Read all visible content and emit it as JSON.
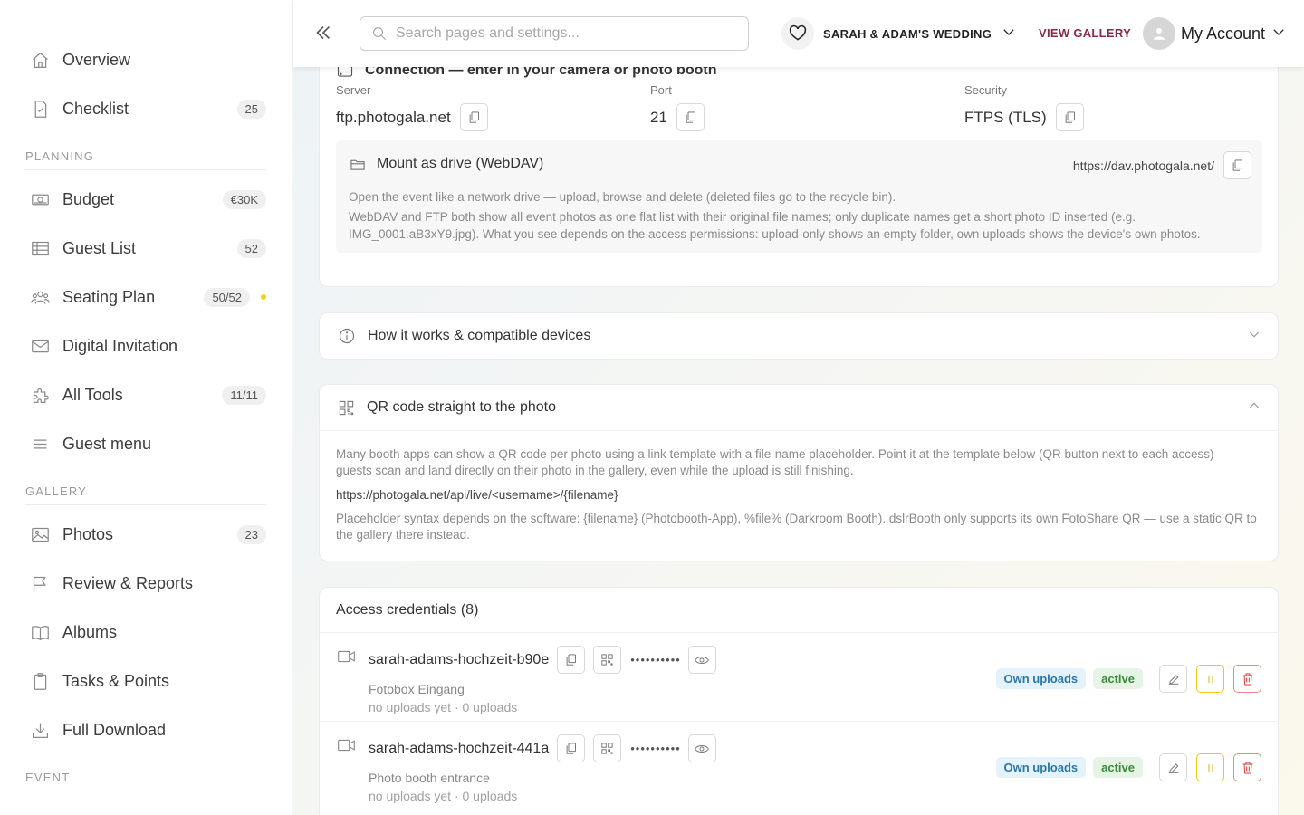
{
  "sidebar": {
    "items_top": [
      {
        "label": "Overview",
        "badge": null,
        "icon": "home-icon"
      },
      {
        "label": "Checklist",
        "badge": "25",
        "icon": "checklist-icon"
      }
    ],
    "section_planning": "PLANNING",
    "items_planning": [
      {
        "label": "Budget",
        "badge": "€30K",
        "icon": "money-icon"
      },
      {
        "label": "Guest List",
        "badge": "52",
        "icon": "table-icon"
      },
      {
        "label": "Seating Plan",
        "badge": "50/52",
        "icon": "people-icon"
      },
      {
        "label": "Digital Invitation",
        "badge": null,
        "icon": "mail-icon"
      },
      {
        "label": "All Tools",
        "badge": "11/11",
        "icon": "puzzle-icon"
      },
      {
        "label": "Guest menu",
        "badge": null,
        "icon": "menu-icon"
      }
    ],
    "section_gallery": "GALLERY",
    "items_gallery": [
      {
        "label": "Photos",
        "badge": "23",
        "icon": "image-icon"
      },
      {
        "label": "Review & Reports",
        "badge": null,
        "icon": "flag-icon"
      },
      {
        "label": "Albums",
        "badge": null,
        "icon": "book-icon"
      },
      {
        "label": "Tasks & Points",
        "badge": null,
        "icon": "clipboard-icon"
      },
      {
        "label": "Full Download",
        "badge": null,
        "icon": "download-icon"
      }
    ],
    "section_event": "EVENT",
    "status_dot_color": "#f5d20c"
  },
  "topbar": {
    "search_placeholder": "Search pages and settings...",
    "event_name": "SARAH & ADAM'S WEDDING",
    "view_gallery": "VIEW GALLERY",
    "account_label": "My Account",
    "accent_color": "#8b2a45"
  },
  "connection": {
    "title": "Connection — enter in your camera or photo booth",
    "server_label": "Server",
    "server_value": "ftp.photogala.net",
    "port_label": "Port",
    "port_value": "21",
    "security_label": "Security",
    "security_value": "FTPS (TLS)",
    "webdav_title": "Mount as drive (WebDAV)",
    "webdav_url": "https://dav.photogala.net/",
    "webdav_text1": "Open the event like a network drive — upload, browse and delete (deleted files go to the recycle bin).",
    "webdav_text2": "WebDAV and FTP both show all event photos as one flat list with their original file names; only duplicate names get a short photo ID inserted (e.g. IMG_0001.aB3xY9.jpg). What you see depends on the access permissions: upload-only shows an empty folder, own uploads shows the device's own photos."
  },
  "how_it_works": {
    "title": "How it works & compatible devices"
  },
  "qr": {
    "title": "QR code straight to the photo",
    "text1": "Many booth apps can show a QR code per photo using a link template with a file-name placeholder. Point it at the template below (QR button next to each access) — guests scan and land directly on their photo in the gallery, even while the upload is still finishing.",
    "template": "https://photogala.net/api/live/<username>/{filename}",
    "text2": "Placeholder syntax depends on the software: {filename} (Photobooth-App), %file% (Darkroom Booth). dslrBooth only supports its own FotoShare QR — use a static QR to the gallery there instead."
  },
  "credentials": {
    "title": "Access credentials (8)",
    "rows": [
      {
        "username": "sarah-adams-hochzeit-b90e",
        "password_mask": "••••••••••",
        "device": "Fotobox Eingang",
        "meta": "no uploads yet · 0 uploads",
        "scope": "Own uploads",
        "status": "active"
      },
      {
        "username": "sarah-adams-hochzeit-441a",
        "password_mask": "••••••••••",
        "device": "Photo booth entrance",
        "meta": "no uploads yet · 0 uploads",
        "scope": "Own uploads",
        "status": "active"
      }
    ]
  }
}
